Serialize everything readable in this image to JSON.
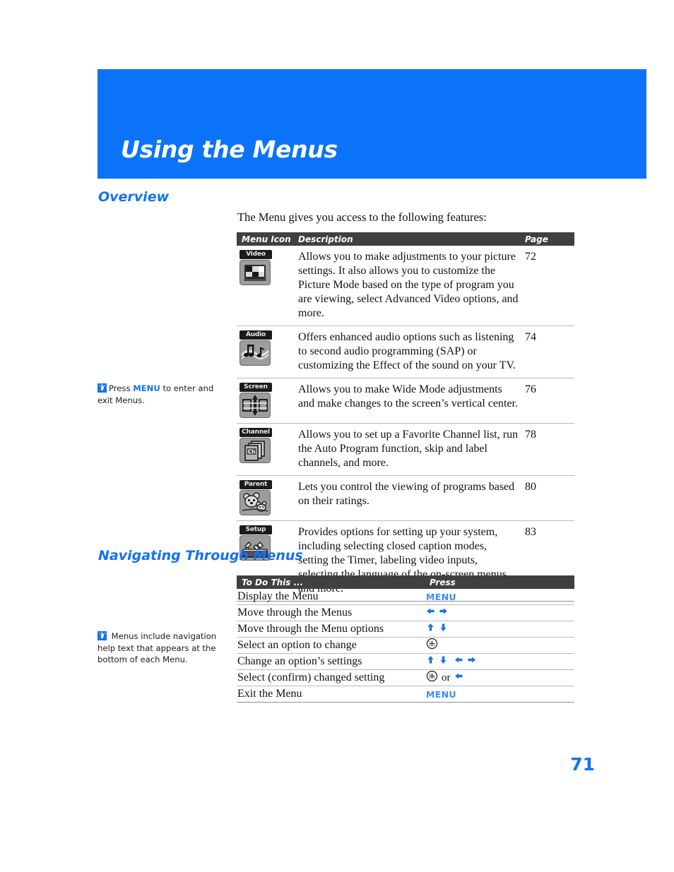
{
  "page": {
    "banner_title": "Using the Menus",
    "page_number": "71",
    "accent_blue": "#0b73f8",
    "header_gray": "#404040"
  },
  "overview": {
    "heading": "Overview",
    "intro": "The Menu gives you access to the following features:",
    "table": {
      "columns": [
        "Menu Icon",
        "Description",
        "Page"
      ],
      "rows": [
        {
          "icon_label": "Video",
          "icon_name": "video-menu-icon",
          "description": "Allows you to make adjustments to your picture settings. It also allows you to customize the Picture Mode based on the type of program you are viewing, select Advanced Video options, and more.",
          "page": "72"
        },
        {
          "icon_label": "Audio",
          "icon_name": "audio-menu-icon",
          "description": "Offers enhanced audio options such as listening to second audio programming (SAP) or customizing the Effect of the sound on your TV.",
          "page": "74"
        },
        {
          "icon_label": "Screen",
          "icon_name": "screen-menu-icon",
          "description": "Allows you to make Wide Mode adjustments and make changes to the screen’s vertical center.",
          "page": "76"
        },
        {
          "icon_label": "Channel",
          "icon_name": "channel-menu-icon",
          "description": "Allows you to set up a Favorite Channel list, run the Auto Program function, skip and label channels, and more.",
          "page": "78"
        },
        {
          "icon_label": "Parent",
          "icon_name": "parent-menu-icon",
          "description": "Lets you control the viewing of programs based on their ratings.",
          "page": "80"
        },
        {
          "icon_label": "Setup",
          "icon_name": "setup-menu-icon",
          "description": "Provides options for  setting up your system, including selecting closed caption modes, setting the Timer, labeling video inputs, selecting the language of the on-screen menus, and more.",
          "page": "83"
        }
      ]
    }
  },
  "navigating": {
    "heading": "Navigating Through Menus",
    "table": {
      "columns": [
        "To Do This ...",
        "Press"
      ],
      "rows": [
        {
          "action": "Display the Menu",
          "press_text": "MENU",
          "press_kind": "menu"
        },
        {
          "action": "Move through the Menus",
          "press_text": "",
          "press_kind": "arrows-lr"
        },
        {
          "action": "Move through the Menu options",
          "press_text": "",
          "press_kind": "arrows-ud"
        },
        {
          "action": "Select an option to change",
          "press_text": "",
          "press_kind": "jog"
        },
        {
          "action": "Change an option’s settings",
          "press_text": "",
          "press_kind": "arrows-all"
        },
        {
          "action": "Select (confirm) changed setting",
          "press_text": "or",
          "press_kind": "jog-or-left"
        },
        {
          "action": "Exit the Menu",
          "press_text": "MENU",
          "press_kind": "menu"
        }
      ]
    }
  },
  "notes": [
    {
      "id": "note-menu",
      "icon": "lightbulb-icon",
      "part1": "Press ",
      "keyword": "MENU",
      "part2": " to enter and exit Menus."
    },
    {
      "id": "note-help",
      "icon": "lightbulb-icon",
      "part1": " Menus include navigation help text that appears at the bottom of each Menu.",
      "keyword": "",
      "part2": ""
    }
  ]
}
